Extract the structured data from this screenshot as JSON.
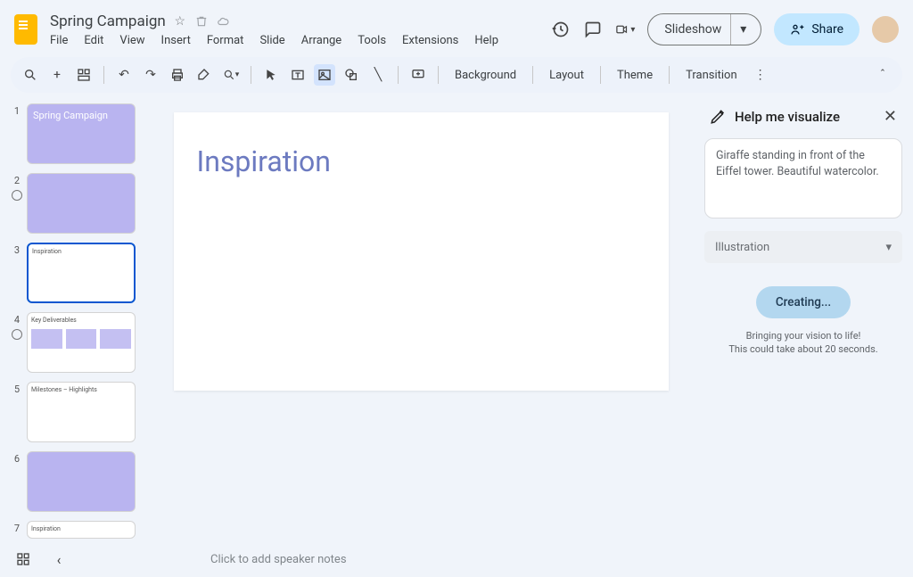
{
  "doc": {
    "title": "Spring Campaign"
  },
  "menus": [
    "File",
    "Edit",
    "View",
    "Insert",
    "Format",
    "Slide",
    "Arrange",
    "Tools",
    "Extensions",
    "Help"
  ],
  "header": {
    "slideshow": "Slideshow",
    "share": "Share"
  },
  "toolbar": {
    "background": "Background",
    "layout": "Layout",
    "theme": "Theme",
    "transition": "Transition"
  },
  "thumbnails": [
    {
      "n": 1,
      "title": "Spring Campaign"
    },
    {
      "n": 2,
      "title": ""
    },
    {
      "n": 3,
      "title": "Inspiration"
    },
    {
      "n": 4,
      "title": "Key Deliverables"
    },
    {
      "n": 5,
      "title": "Milestones – Highlights"
    },
    {
      "n": 6,
      "title": ""
    },
    {
      "n": 7,
      "title": "Inspiration"
    }
  ],
  "canvas": {
    "title": "Inspiration"
  },
  "panel": {
    "title": "Help me visualize",
    "prompt": "Giraffe standing in front of the Eiffel tower. Beautiful watercolor.",
    "style": "Illustration",
    "button": "Creating...",
    "status_l1": "Bringing your vision to life!",
    "status_l2": "This could take about 20 seconds."
  },
  "bottom": {
    "notes_placeholder": "Click to add speaker notes"
  }
}
